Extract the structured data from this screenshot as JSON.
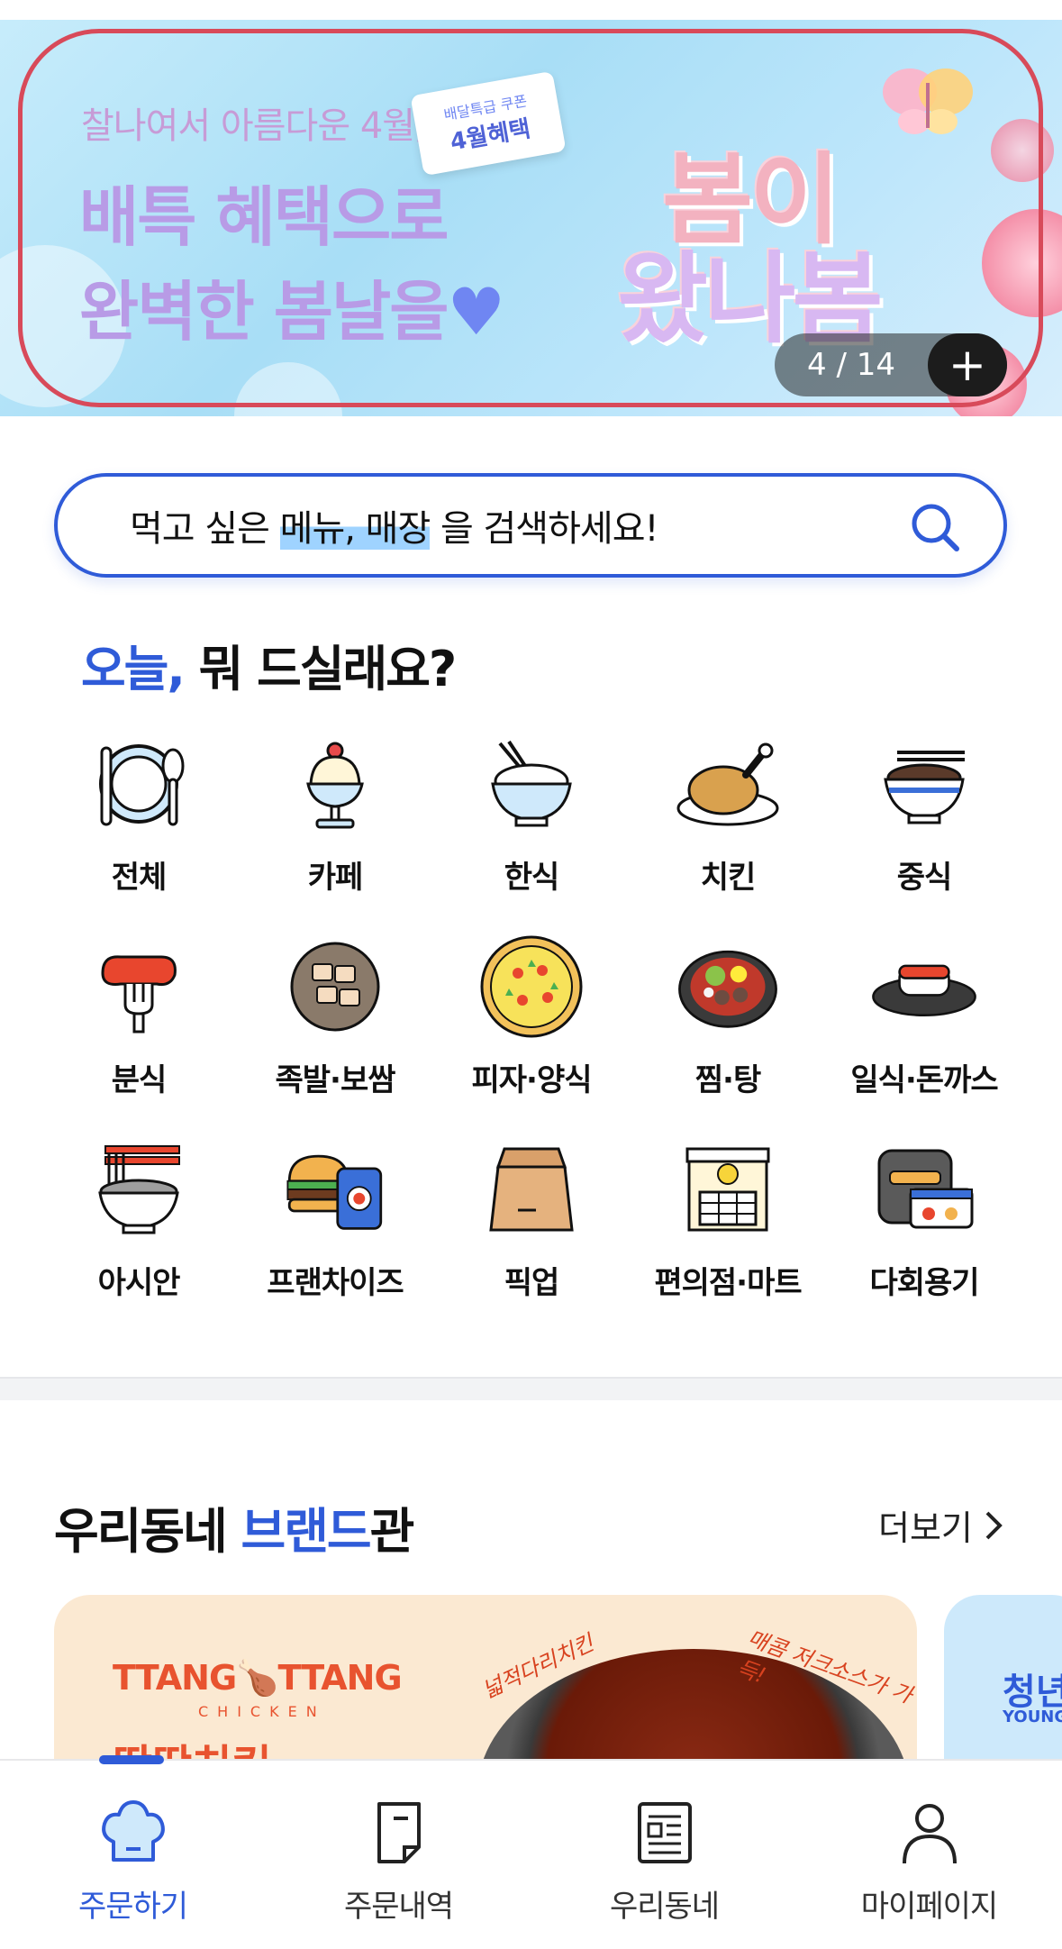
{
  "banner": {
    "subtitle": "찰나여서 아름다운 4월,",
    "headline_line1": "배특 혜택으로",
    "headline_line2": "완벽한 봄날을",
    "heart": "♥",
    "coupon_small": "배달특급 쿠폰",
    "coupon_big": "4월혜택",
    "big_line1": "봄이",
    "big_line2": "왔나봄",
    "counter": "4 / 14",
    "plus": "+"
  },
  "search": {
    "prefix": "먹고 싶은 ",
    "highlight": "메뉴, 매장",
    "suffix": " 을 검색하세요!"
  },
  "today": {
    "accent": "오늘,",
    "rest": " 뭐 드실래요?"
  },
  "categories": [
    {
      "label": "전체",
      "icon": "plate-utensils-icon"
    },
    {
      "label": "카페",
      "icon": "parfait-icon"
    },
    {
      "label": "한식",
      "icon": "rice-bowl-icon"
    },
    {
      "label": "치킨",
      "icon": "roast-chicken-icon"
    },
    {
      "label": "중식",
      "icon": "noodle-bowl-icon"
    },
    {
      "label": "분식",
      "icon": "sausage-fork-icon"
    },
    {
      "label": "족발·보쌈",
      "icon": "pork-plate-icon"
    },
    {
      "label": "피자·양식",
      "icon": "pizza-icon"
    },
    {
      "label": "찜·탕",
      "icon": "hot-pot-icon"
    },
    {
      "label": "일식·돈까스",
      "icon": "sushi-icon"
    },
    {
      "label": "아시안",
      "icon": "asian-noodle-icon"
    },
    {
      "label": "프랜차이즈",
      "icon": "burger-can-icon"
    },
    {
      "label": "픽업",
      "icon": "paper-bag-icon"
    },
    {
      "label": "편의점·마트",
      "icon": "convenience-store-icon"
    },
    {
      "label": "다회용기",
      "icon": "reusable-container-icon"
    }
  ],
  "brand_section": {
    "title_start": "우리동네 ",
    "title_accent": "브랜드",
    "title_end": "관",
    "more": "더보기",
    "card1": {
      "logo": "TTANG🍗TTANG",
      "logo_sub": "CHICKEN",
      "name": "땅땅치킨",
      "tag1": "넓적다리치킨",
      "tag2": "매콤 저크소스가 가득!"
    },
    "card2": {
      "title": "청년",
      "sub": "YOUNG"
    }
  },
  "nav": [
    {
      "label": "주문하기",
      "icon": "chef-hat-icon",
      "active": true
    },
    {
      "label": "주문내역",
      "icon": "receipt-icon",
      "active": false
    },
    {
      "label": "우리동네",
      "icon": "newspaper-icon",
      "active": false
    },
    {
      "label": "마이페이지",
      "icon": "person-icon",
      "active": false
    }
  ],
  "colors": {
    "accent": "#2f5bd8",
    "banner_outline": "#d84a5a"
  }
}
